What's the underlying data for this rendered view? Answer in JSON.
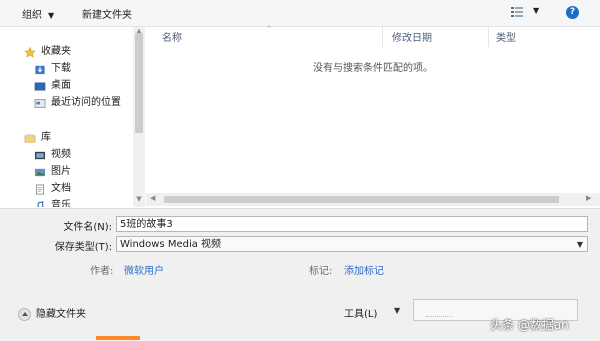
{
  "toolbar": {
    "organize": "组织",
    "new_folder": "新建文件夹",
    "help": "?"
  },
  "nav": {
    "favorites": "收藏夹",
    "downloads": "下载",
    "desktop": "桌面",
    "recent": "最近访问的位置",
    "libraries": "库",
    "videos": "视频",
    "pictures": "图片",
    "documents": "文档",
    "music_partial": "音乐"
  },
  "columns": {
    "name": "名称",
    "date_modified": "修改日期",
    "type": "类型"
  },
  "empty_message": "没有与搜索条件匹配的项。",
  "form": {
    "filename_label": "文件名(N):",
    "filename_value": "5班的故事3",
    "filetype_label": "保存类型(T):",
    "filetype_value": "Windows Media 视频",
    "author_label": "作者:",
    "author_value": "微软用户",
    "tags_label": "标记:",
    "tags_value": "添加标记",
    "hide_folders": "隐藏文件夹",
    "tools": "工具(L)"
  },
  "watermark": "头条 @数据an"
}
